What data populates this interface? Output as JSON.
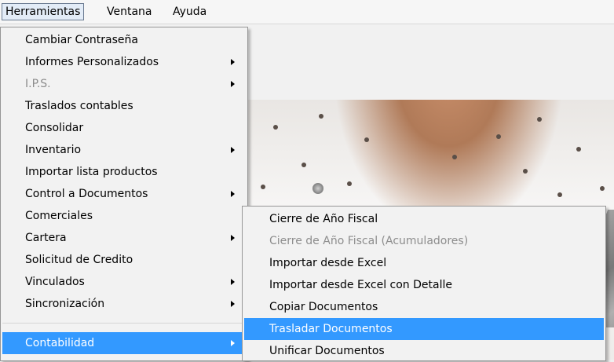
{
  "menubar": {
    "items": [
      {
        "label": "Herramientas"
      },
      {
        "label": "Ventana"
      },
      {
        "label": "Ayuda"
      }
    ]
  },
  "herramientas_menu": {
    "items": [
      {
        "label": "Cambiar Contraseña",
        "submenu": false,
        "disabled": false
      },
      {
        "label": "Informes Personalizados",
        "submenu": true,
        "disabled": false
      },
      {
        "label": "I.P.S.",
        "submenu": true,
        "disabled": true
      },
      {
        "label": "Traslados contables",
        "submenu": false,
        "disabled": false
      },
      {
        "label": "Consolidar",
        "submenu": false,
        "disabled": false
      },
      {
        "label": "Inventario",
        "submenu": true,
        "disabled": false
      },
      {
        "label": "Importar lista productos",
        "submenu": false,
        "disabled": false
      },
      {
        "label": "Control a Documentos",
        "submenu": true,
        "disabled": false
      },
      {
        "label": "Comerciales",
        "submenu": false,
        "disabled": false
      },
      {
        "label": "Cartera",
        "submenu": true,
        "disabled": false
      },
      {
        "label": "Solicitud de Credito",
        "submenu": false,
        "disabled": false
      },
      {
        "label": "Vinculados",
        "submenu": true,
        "disabled": false
      },
      {
        "label": "Sincronización",
        "submenu": true,
        "disabled": false
      },
      {
        "label": "Contabilidad",
        "submenu": true,
        "disabled": false,
        "highlighted": true
      }
    ]
  },
  "contabilidad_submenu": {
    "items": [
      {
        "label": "Cierre de Año Fiscal",
        "disabled": false
      },
      {
        "label": "Cierre de Año Fiscal (Acumuladores)",
        "disabled": true
      },
      {
        "label": "Importar desde Excel",
        "disabled": false
      },
      {
        "label": "Importar desde Excel con Detalle",
        "disabled": false
      },
      {
        "label": "Copiar Documentos",
        "disabled": false
      },
      {
        "label": "Trasladar Documentos",
        "disabled": false,
        "highlighted": true
      },
      {
        "label": "Unificar Documentos",
        "disabled": false
      }
    ]
  },
  "colors": {
    "highlight": "#3399ff",
    "disabled_text": "#8d8d8d"
  }
}
